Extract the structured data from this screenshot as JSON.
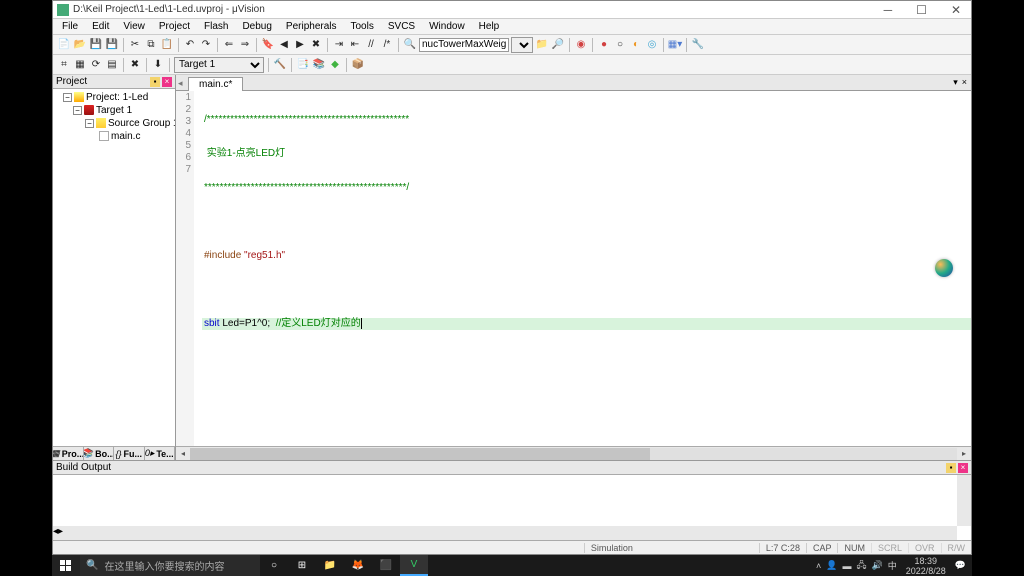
{
  "window": {
    "title": "D:\\Keil Project\\1-Led\\1-Led.uvproj - μVision"
  },
  "menu": [
    "File",
    "Edit",
    "View",
    "Project",
    "Flash",
    "Debug",
    "Peripherals",
    "Tools",
    "SVCS",
    "Window",
    "Help"
  ],
  "toolbar": {
    "target": "Target 1",
    "search_field": "nucTowerMaxWeight="
  },
  "project_panel": {
    "title": "Project",
    "nodes": {
      "root": "Project: 1-Led",
      "target": "Target 1",
      "group": "Source Group 1",
      "file": "main.c"
    },
    "tabs": [
      "Pro...",
      "Bo...",
      "Fu...",
      "Te..."
    ]
  },
  "editor": {
    "tab": "main.c*",
    "lines": {
      "l1": "/****************************************************",
      "l2_a": " 实验1-点亮LED灯",
      "l3": "****************************************************/",
      "l4": "",
      "l5_a": "#include",
      "l5_b": " \"reg51.h\"",
      "l6": "",
      "l7_a": "sbit",
      "l7_b": " Led=P1^0;  ",
      "l7_c": "//定义LED灯对应的"
    }
  },
  "build_output": {
    "title": "Build Output"
  },
  "status": {
    "sim": "Simulation",
    "pos": "L:7 C:28",
    "caps": "CAP",
    "num": "NUM",
    "scrl": "SCRL",
    "ovr": "OVR",
    "rw": "R/W"
  },
  "taskbar": {
    "search_placeholder": "在这里输入你要搜索的内容",
    "ime": "中",
    "time": "18:39",
    "date": "2022/8/28"
  }
}
